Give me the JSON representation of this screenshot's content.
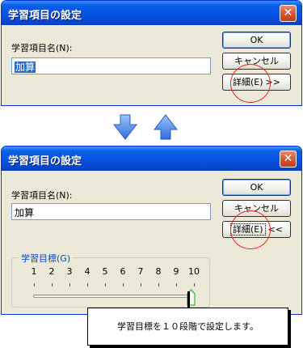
{
  "dialog_before": {
    "title": "学習項目の設定",
    "close_glyph": "✕",
    "name_label": "学習項目名(N):",
    "name_value": "加算",
    "ok_label": "OK",
    "cancel_label": "キャンセル",
    "details_label": "詳細(E)",
    "details_arrow": ">>"
  },
  "dialog_after": {
    "title": "学習項目の設定",
    "close_glyph": "✕",
    "name_label": "学習項目名(N):",
    "name_value": "加算",
    "ok_label": "OK",
    "cancel_label": "キャンセル",
    "details_label": "詳細(E)",
    "details_arrow": "<<",
    "goal_group": {
      "legend": "学習目標(G)",
      "ticks": [
        "1",
        "2",
        "3",
        "4",
        "5",
        "6",
        "7",
        "8",
        "9",
        "10"
      ],
      "slider_value": 10,
      "slider_min": 1,
      "slider_max": 10
    }
  },
  "transition_icons": {
    "down": "blue-down-arrow-icon",
    "up": "blue-up-arrow-icon"
  },
  "colors": {
    "titlebar_blue": "#0553e3",
    "dialog_face": "#ece9d8",
    "highlight_circle": "#e3262a",
    "selection": "#316ac5",
    "arrow_blue": "#3b78e0"
  },
  "callout": {
    "text": "学習目標を１０段階で設定します。"
  }
}
